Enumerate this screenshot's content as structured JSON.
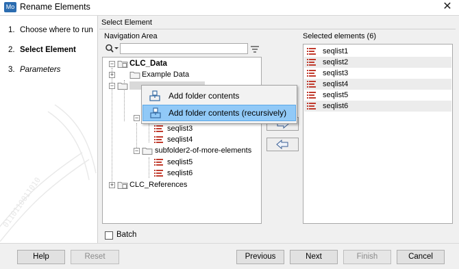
{
  "window": {
    "app_icon_text": "Mo",
    "title": "Rename Elements"
  },
  "steps": [
    {
      "num": "1.",
      "label": "Choose where to run",
      "style": "normal"
    },
    {
      "num": "2.",
      "label": "Select Element",
      "style": "bold"
    },
    {
      "num": "3.",
      "label": "Parameters",
      "style": "italic"
    }
  ],
  "main": {
    "section_title": "Select Element",
    "navigation_area_label": "Navigation Area",
    "selected_label": "Selected elements (6)",
    "search": {
      "value": "",
      "placeholder": ""
    }
  },
  "tree": {
    "root": "CLC_Data",
    "example_data": "Example Data",
    "seq3": "seqlist3",
    "seq4": "seqlist4",
    "subfolder2": "subfolder2-of-more-elements",
    "seq5": "seqlist5",
    "seq6": "seqlist6",
    "references": "CLC_References"
  },
  "selected_elements": [
    "seqlist1",
    "seqlist2",
    "seqlist3",
    "seqlist4",
    "seqlist5",
    "seqlist6"
  ],
  "context_menu": {
    "items": [
      {
        "label": "Add folder contents",
        "highlighted": false
      },
      {
        "label": "Add folder contents (recursively)",
        "highlighted": true
      }
    ]
  },
  "batch_label": "Batch",
  "buttons": {
    "help": "Help",
    "reset": "Reset",
    "previous": "Previous",
    "next": "Next",
    "finish": "Finish",
    "cancel": "Cancel"
  },
  "colors": {
    "highlight": "#91c9f7",
    "seq_icon_red": "#c0392b",
    "folder_yellow": "#e8d28a"
  }
}
